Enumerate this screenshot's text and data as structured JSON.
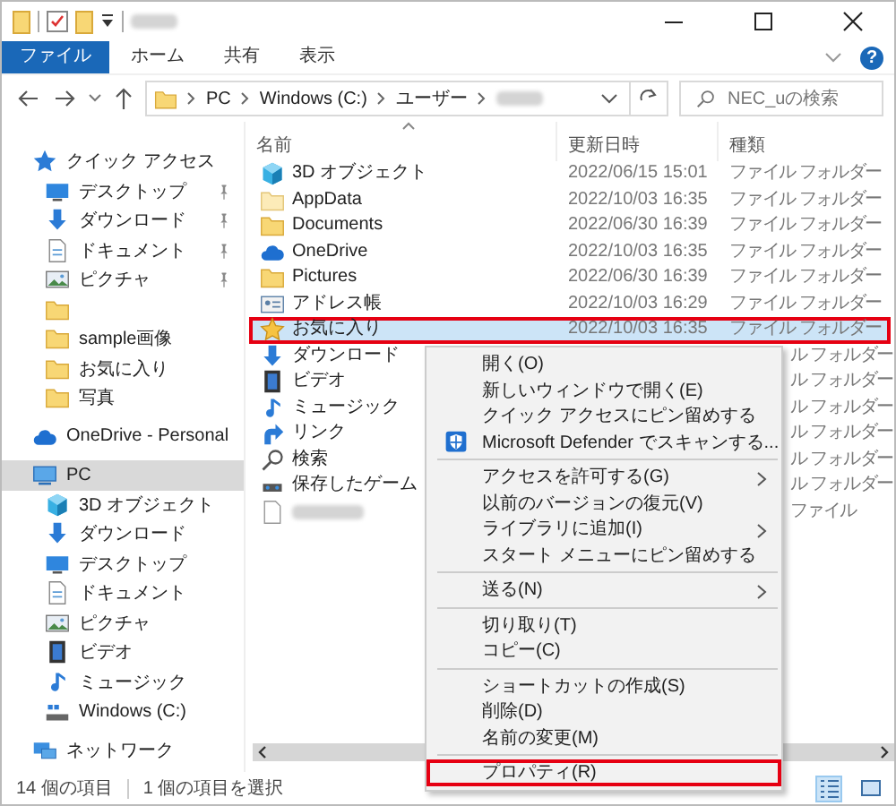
{
  "ribbon": {
    "tabs": [
      {
        "label": "ファイル",
        "selected": true
      },
      {
        "label": "ホーム",
        "selected": false
      },
      {
        "label": "共有",
        "selected": false
      },
      {
        "label": "表示",
        "selected": false
      }
    ],
    "help_label": "?"
  },
  "address": {
    "crumbs": [
      "PC",
      "Windows (C:)",
      "ユーザー"
    ],
    "search": {
      "placeholder": "NEC_uの検索"
    }
  },
  "nav": [
    {
      "label": "クイック アクセス",
      "kind": "star-blue",
      "selected": false,
      "children": [
        {
          "label": "デスクトップ",
          "kind": "desktop",
          "pinned": true,
          "selected": false
        },
        {
          "label": "ダウンロード",
          "kind": "download",
          "pinned": true,
          "selected": false
        },
        {
          "label": "ドキュメント",
          "kind": "document",
          "pinned": true,
          "selected": false
        },
        {
          "label": "ピクチャ",
          "kind": "picture",
          "pinned": true,
          "selected": false
        },
        {
          "kind": "folder",
          "pinned": false,
          "selected": false
        },
        {
          "label": "sample画像",
          "kind": "folder",
          "pinned": false,
          "selected": false
        },
        {
          "label": "お気に入り",
          "kind": "folder",
          "pinned": false,
          "selected": false
        },
        {
          "label": "写真",
          "kind": "folder",
          "pinned": false,
          "selected": false
        }
      ]
    },
    {
      "label": "OneDrive - Personal",
      "kind": "cloud",
      "selected": false
    },
    {
      "label": "PC",
      "kind": "pc",
      "selected": true,
      "children": [
        {
          "label": "3D オブジェクト",
          "kind": "cube",
          "pinned": false,
          "selected": false
        },
        {
          "label": "ダウンロード",
          "kind": "download",
          "pinned": false,
          "selected": false
        },
        {
          "label": "デスクトップ",
          "kind": "desktop",
          "pinned": false,
          "selected": false
        },
        {
          "label": "ドキュメント",
          "kind": "document",
          "pinned": false,
          "selected": false
        },
        {
          "label": "ピクチャ",
          "kind": "picture",
          "pinned": false,
          "selected": false
        },
        {
          "label": "ビデオ",
          "kind": "video",
          "pinned": false,
          "selected": false
        },
        {
          "label": "ミュージック",
          "kind": "music",
          "pinned": false,
          "selected": false
        },
        {
          "label": "Windows (C:)",
          "kind": "drive",
          "pinned": false,
          "selected": false
        }
      ]
    },
    {
      "label": "ネットワーク",
      "kind": "network",
      "selected": false
    }
  ],
  "table": {
    "columns": [
      {
        "label": "名前",
        "sorted": true
      },
      {
        "label": "更新日時",
        "sorted": false
      },
      {
        "label": "種類",
        "sorted": false
      }
    ],
    "rows": [
      {
        "name": "3D オブジェクト",
        "kind": "cube",
        "date": "2022/06/15 15:01",
        "type": "ファイル フォルダー",
        "selected": false,
        "highlighted": false
      },
      {
        "name": "AppData",
        "kind": "folder-pale",
        "date": "2022/10/03 16:35",
        "type": "ファイル フォルダー",
        "selected": false,
        "highlighted": false
      },
      {
        "name": "Documents",
        "kind": "folder",
        "date": "2022/06/30 16:39",
        "type": "ファイル フォルダー",
        "selected": false,
        "highlighted": false
      },
      {
        "name": "OneDrive",
        "kind": "cloud",
        "date": "2022/10/03 16:35",
        "type": "ファイル フォルダー",
        "selected": false,
        "highlighted": false
      },
      {
        "name": "Pictures",
        "kind": "folder",
        "date": "2022/06/30 16:39",
        "type": "ファイル フォルダー",
        "selected": false,
        "highlighted": false
      },
      {
        "name": "アドレス帳",
        "kind": "contacts",
        "date": "2022/10/03 16:29",
        "type": "ファイル フォルダー",
        "selected": false,
        "highlighted": false
      },
      {
        "name": "お気に入り",
        "kind": "star",
        "date": "2022/10/03 16:35",
        "type": "ファイル フォルダー",
        "selected": true,
        "highlighted": true
      },
      {
        "name": "ダウンロード",
        "kind": "download",
        "type": "ル フォルダー",
        "selected": false,
        "highlighted": false
      },
      {
        "name": "ビデオ",
        "kind": "video",
        "type": "ル フォルダー",
        "selected": false,
        "highlighted": false
      },
      {
        "name": "ミュージック",
        "kind": "music",
        "type": "ル フォルダー",
        "selected": false,
        "highlighted": false
      },
      {
        "name": "リンク",
        "kind": "link",
        "type": "ル フォルダー",
        "selected": false,
        "highlighted": false
      },
      {
        "name": "検索",
        "kind": "search",
        "type": "ル フォルダー",
        "selected": false,
        "highlighted": false
      },
      {
        "name": "保存したゲーム",
        "kind": "game",
        "type": "ル フォルダー",
        "selected": false,
        "highlighted": false
      },
      {
        "kind": "file",
        "blurred_name": true,
        "type": "ファイル",
        "selected": false,
        "highlighted": false
      }
    ]
  },
  "context_menu": [
    {
      "kind": "item",
      "label": "開く(O)",
      "submenu": false,
      "highlighted": false
    },
    {
      "kind": "item",
      "label": "新しいウィンドウで開く(E)",
      "submenu": false,
      "highlighted": false
    },
    {
      "kind": "item",
      "label": "クイック アクセスにピン留めする",
      "submenu": false,
      "highlighted": false
    },
    {
      "kind": "icon-item",
      "label": "Microsoft Defender でスキャンする...",
      "submenu": false,
      "highlighted": false
    },
    {
      "kind": "separator"
    },
    {
      "kind": "item",
      "label": "アクセスを許可する(G)",
      "submenu": true,
      "highlighted": false
    },
    {
      "kind": "item",
      "label": "以前のバージョンの復元(V)",
      "submenu": false,
      "highlighted": false
    },
    {
      "kind": "item",
      "label": "ライブラリに追加(I)",
      "submenu": true,
      "highlighted": false
    },
    {
      "kind": "item",
      "label": "スタート メニューにピン留めする",
      "submenu": false,
      "highlighted": false
    },
    {
      "kind": "separator"
    },
    {
      "kind": "item",
      "label": "送る(N)",
      "submenu": true,
      "highlighted": false
    },
    {
      "kind": "separator"
    },
    {
      "kind": "item",
      "label": "切り取り(T)",
      "submenu": false,
      "highlighted": false
    },
    {
      "kind": "item",
      "label": "コピー(C)",
      "submenu": false,
      "highlighted": false
    },
    {
      "kind": "separator"
    },
    {
      "kind": "item",
      "label": "ショートカットの作成(S)",
      "submenu": false,
      "highlighted": false
    },
    {
      "kind": "item",
      "label": "削除(D)",
      "submenu": false,
      "highlighted": false
    },
    {
      "kind": "item",
      "label": "名前の変更(M)",
      "submenu": false,
      "highlighted": false
    },
    {
      "kind": "separator"
    },
    {
      "kind": "item",
      "label": "プロパティ(R)",
      "submenu": false,
      "highlighted": true
    }
  ],
  "status_bar": {
    "count": "14 個の項目",
    "selection": "1 個の項目を選択"
  },
  "view_buttons": [
    {
      "kind": "details",
      "selected": true
    },
    {
      "kind": "large-icons",
      "selected": false
    }
  ]
}
